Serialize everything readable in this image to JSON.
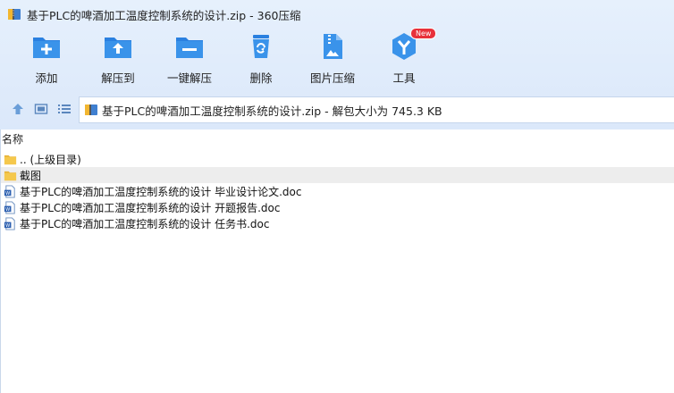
{
  "window": {
    "title": "基于PLC的啤酒加工温度控制系统的设计.zip - 360压缩"
  },
  "toolbar": {
    "buttons": [
      {
        "label": "添加",
        "icon": "add-icon"
      },
      {
        "label": "解压到",
        "icon": "extract-to-icon"
      },
      {
        "label": "一键解压",
        "icon": "one-click-extract-icon"
      },
      {
        "label": "删除",
        "icon": "delete-icon"
      },
      {
        "label": "图片压缩",
        "icon": "image-compress-icon"
      },
      {
        "label": "工具",
        "icon": "tools-icon",
        "badge": "New"
      }
    ]
  },
  "addressbar": {
    "path": "基于PLC的啤酒加工温度控制系统的设计.zip - 解包大小为 745.3 KB"
  },
  "filelist": {
    "column_name": "名称",
    "rows": [
      {
        "name": ".. (上级目录)",
        "type": "folder",
        "selected": false
      },
      {
        "name": "截图",
        "type": "folder",
        "selected": true
      },
      {
        "name": "基于PLC的啤酒加工温度控制系统的设计 毕业设计论文.doc",
        "type": "doc",
        "selected": false
      },
      {
        "name": "基于PLC的啤酒加工温度控制系统的设计 开题报告.doc",
        "type": "doc",
        "selected": false
      },
      {
        "name": "基于PLC的啤酒加工温度控制系统的设计 任务书.doc",
        "type": "doc",
        "selected": false
      }
    ]
  },
  "colors": {
    "accent": "#2d8de5",
    "badge": "#e8313b",
    "folder": "#f5c84c",
    "selected_row": "#ededed"
  }
}
